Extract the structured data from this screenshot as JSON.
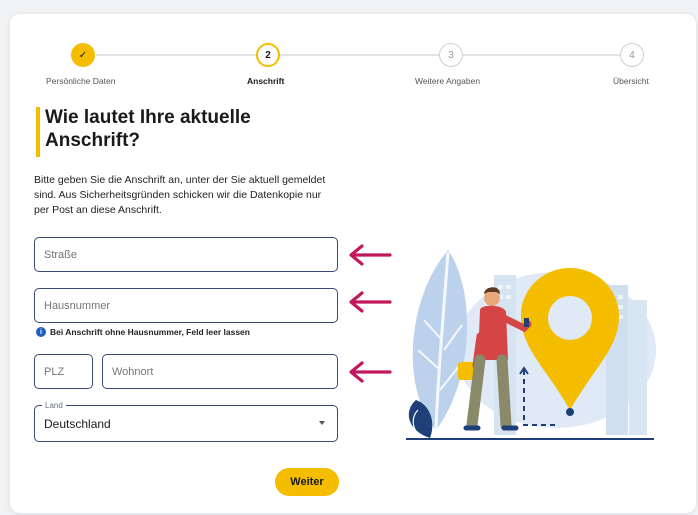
{
  "stepper": {
    "steps": [
      {
        "number": "✓",
        "label": "Persönliche Daten",
        "state": "done"
      },
      {
        "number": "2",
        "label": "Anschrift",
        "state": "active"
      },
      {
        "number": "3",
        "label": "Weitere Angaben",
        "state": "todo"
      },
      {
        "number": "4",
        "label": "Übersicht",
        "state": "todo"
      }
    ]
  },
  "heading": "Wie lautet Ihre aktuelle Anschrift?",
  "description": "Bitte geben Sie die Anschrift an, unter der Sie aktuell gemeldet sind. Aus Sicherheitsgründen schicken wir die Datenkopie nur per Post an diese Anschrift.",
  "form": {
    "street_placeholder": "Straße",
    "house_number_placeholder": "Hausnummer",
    "house_number_hint": "Bei Anschrift ohne Hausnummer, Feld leer lassen",
    "zip_placeholder": "PLZ",
    "city_placeholder": "Wohnort",
    "country_label": "Land",
    "country_value": "Deutschland"
  },
  "submit_label": "Weiter",
  "colors": {
    "accent": "#f5bd00",
    "field_border": "#3a4b78",
    "arrow": "#c2185b",
    "info": "#1f5fbf"
  }
}
